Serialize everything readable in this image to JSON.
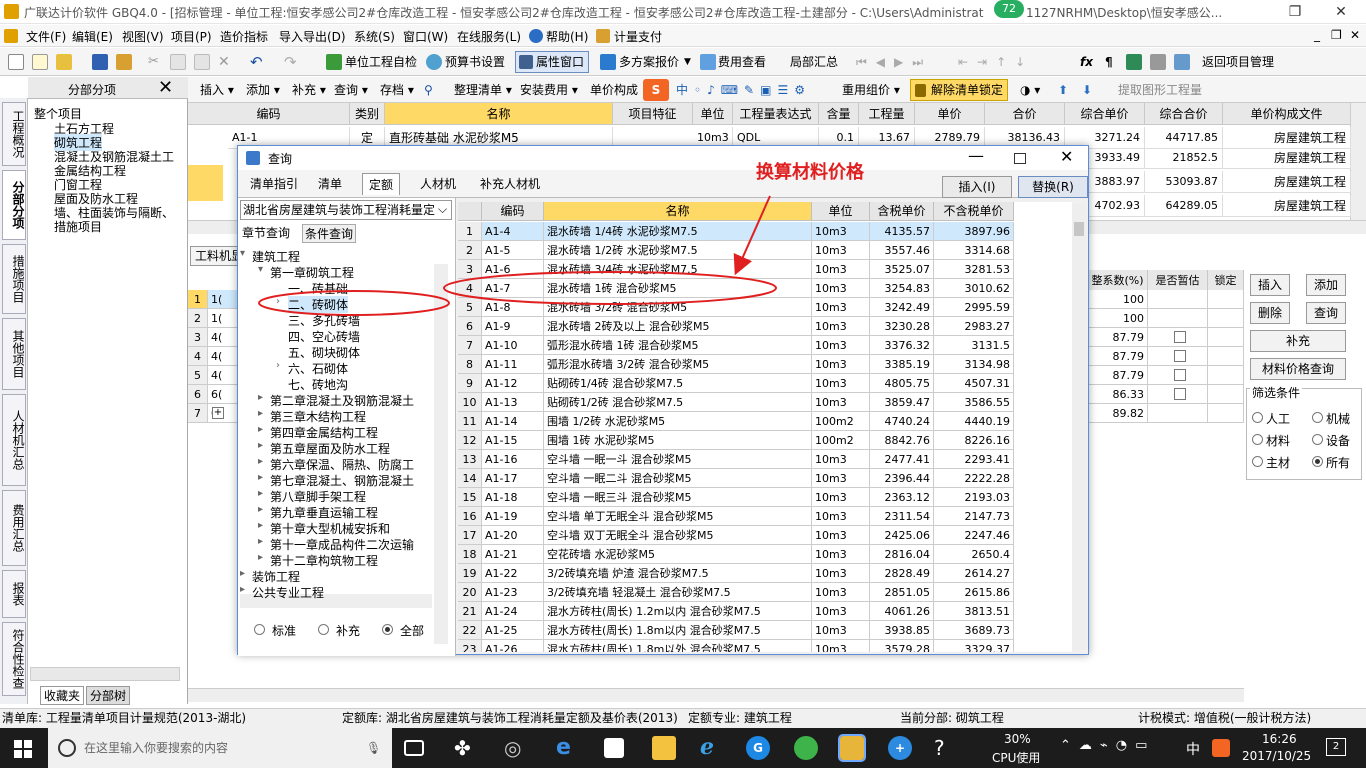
{
  "window": {
    "title": "广联达计价软件 GBQ4.0 - [招标管理 - 单位工程:恒安孝感公司2#仓库改造工程 - 恒安孝感公司2#仓库改造工程 - 恒安孝感公司2#仓库改造工程-土建部分 - C:\\Users\\Administrator.P",
    "title_tail": "1127NRHM\\Desktop\\恒安孝感公...",
    "badge": "72"
  },
  "menu": [
    "文件(F)",
    "编辑(E)",
    "视图(V)",
    "项目(P)",
    "造价指标",
    "导入导出(D)",
    "系统(S)",
    "窗口(W)",
    "在线服务(L)",
    "帮助(H)",
    "计量支付"
  ],
  "toolbar1": {
    "self_check": "单位工程自检",
    "budget_settings": "预算书设置",
    "property_window": "属性窗口",
    "multi_scheme": "多方案报价",
    "fee_view": "费用查看",
    "local_summary": "局部汇总",
    "return_project": "返回项目管理"
  },
  "toolbar2": {
    "insert": "插入",
    "add": "添加",
    "supplement": "补充",
    "query": "查询",
    "save": "存档",
    "organize": "整理清单",
    "install_fee": "安装费用",
    "unit_composition": "单价构成",
    "regroup": "重用组价",
    "unlock": "解除清单锁定",
    "extract": "提取图形工程量"
  },
  "left_panel": {
    "title": "分部分项",
    "items": [
      "整个项目",
      "土石方工程",
      "砌筑工程",
      "混凝土及钢筋混凝土工",
      "金属结构工程",
      "门窗工程",
      "屋面及防水工程",
      "墙、柱面装饰与隔断、",
      "措施项目"
    ],
    "bottom_tabs": [
      "收藏夹",
      "分部树"
    ]
  },
  "vertical_tabs": [
    "工程概况",
    "分部分项",
    "措施项目",
    "其他项目",
    "人材机汇总",
    "费用汇总",
    "报表",
    "符合性检查"
  ],
  "main_grid": {
    "headers": [
      "编码",
      "类别",
      "名称",
      "项目特征",
      "单位",
      "工程量表达式",
      "含量",
      "工程量",
      "单价",
      "合价",
      "综合单价",
      "综合合价",
      "单价构成文件"
    ],
    "row1": {
      "code": "A1-1",
      "type": "定",
      "name": "直形砖基础 水泥砂浆M5",
      "unit": "10m3",
      "expr": "QDL",
      "content": "0.1",
      "qty": "13.67",
      "price": "2789.79",
      "total": "38136.43"
    },
    "right_cols": [
      {
        "unit_price": "3271.24",
        "total": "44717.85",
        "file": "房屋建筑工程"
      },
      {
        "unit_price": "3933.49",
        "total": "21852.5",
        "file": "房屋建筑工程"
      },
      {
        "unit_price": "3883.97",
        "total": "53093.87",
        "file": "房屋建筑工程"
      },
      {
        "unit_price": "4702.93",
        "total": "64289.05",
        "file": "房屋建筑工程"
      }
    ]
  },
  "lower_grid": {
    "tab": "工料机显",
    "headers": [
      "整系数(%)",
      "是否暂估",
      "锁定"
    ],
    "rows": [
      {
        "n": "1",
        "c": "1(",
        "v": "100"
      },
      {
        "n": "2",
        "c": "1(",
        "v": "100"
      },
      {
        "n": "3",
        "c": "4(",
        "v": "87.79"
      },
      {
        "n": "4",
        "c": "4(",
        "v": "87.79"
      },
      {
        "n": "5",
        "c": "4(",
        "v": "87.79"
      },
      {
        "n": "6",
        "c": "6(",
        "v": "86.33"
      },
      {
        "n": "7",
        "c": "0(",
        "v": "89.82"
      }
    ]
  },
  "right_panel": {
    "insert": "插入",
    "add": "添加",
    "delete": "删除",
    "query": "查询",
    "supplement": "补充",
    "material_query": "材料价格查询",
    "filter_title": "筛选条件",
    "filters": [
      "人工",
      "机械",
      "材料",
      "设备",
      "主材",
      "所有"
    ],
    "filter_selected": "所有"
  },
  "dialog": {
    "title": "查询",
    "tabs": [
      "清单指引",
      "清单",
      "定额",
      "人材机",
      "补充人材机"
    ],
    "active_tab": "定额",
    "insert_btn": "插入(I)",
    "replace_btn": "替换(R)",
    "library": "湖北省房屋建筑与装饰工程消耗量定",
    "subtabs": [
      "章节查询",
      "条件查询"
    ],
    "tree": [
      "建筑工程",
      "第一章砌筑工程",
      "一、砖基础",
      "二、砖砌体",
      "三、多孔砖墙",
      "四、空心砖墙",
      "五、砌块砌体",
      "六、石砌体",
      "七、砖地沟",
      "第二章混凝土及钢筋混凝土",
      "第三章木结构工程",
      "第四章金属结构工程",
      "第五章屋面及防水工程",
      "第六章保温、隔热、防腐工",
      "第七章混凝土、钢筋混凝土",
      "第八章脚手架工程",
      "第九章垂直运输工程",
      "第十章大型机械安拆和",
      "第十一章成品构件二次运输",
      "第十二章构筑物工程",
      "装饰工程",
      "公共专业工程"
    ],
    "radios": [
      "标准",
      "补充",
      "全部"
    ],
    "radio_selected": "全部",
    "table_headers": [
      "编码",
      "名称",
      "单位",
      "含税单价",
      "不含税单价"
    ],
    "rows": [
      [
        "1",
        "A1-4",
        "混水砖墙 1/4砖 水泥砂浆M7.5",
        "10m3",
        "4135.57",
        "3897.96"
      ],
      [
        "2",
        "A1-5",
        "混水砖墙 1/2砖 水泥砂浆M7.5",
        "10m3",
        "3557.46",
        "3314.68"
      ],
      [
        "3",
        "A1-6",
        "混水砖墙 3/4砖 水泥砂浆M7.5",
        "10m3",
        "3525.07",
        "3281.53"
      ],
      [
        "4",
        "A1-7",
        "混水砖墙 1砖 混合砂浆M5",
        "10m3",
        "3254.83",
        "3010.62"
      ],
      [
        "5",
        "A1-8",
        "混水砖墙 3/2砖 混合砂浆M5",
        "10m3",
        "3242.49",
        "2995.59"
      ],
      [
        "6",
        "A1-9",
        "混水砖墙 2砖及以上 混合砂浆M5",
        "10m3",
        "3230.28",
        "2983.27"
      ],
      [
        "7",
        "A1-10",
        "弧形混水砖墙 1砖 混合砂浆M5",
        "10m3",
        "3376.32",
        "3131.5"
      ],
      [
        "8",
        "A1-11",
        "弧形混水砖墙 3/2砖 混合砂浆M5",
        "10m3",
        "3385.19",
        "3134.98"
      ],
      [
        "9",
        "A1-12",
        "贴砌砖1/4砖 混合砂浆M7.5",
        "10m3",
        "4805.75",
        "4507.31"
      ],
      [
        "10",
        "A1-13",
        "贴砌砖1/2砖 混合砂浆M7.5",
        "10m3",
        "3859.47",
        "3586.55"
      ],
      [
        "11",
        "A1-14",
        "围墙 1/2砖 水泥砂浆M5",
        "100m2",
        "4740.24",
        "4440.19"
      ],
      [
        "12",
        "A1-15",
        "围墙 1砖 水泥砂浆M5",
        "100m2",
        "8842.76",
        "8226.16"
      ],
      [
        "13",
        "A1-16",
        "空斗墙 一眠一斗 混合砂浆M5",
        "10m3",
        "2477.41",
        "2293.41"
      ],
      [
        "14",
        "A1-17",
        "空斗墙 一眠二斗 混合砂浆M5",
        "10m3",
        "2396.44",
        "2222.28"
      ],
      [
        "15",
        "A1-18",
        "空斗墙 一眠三斗 混合砂浆M5",
        "10m3",
        "2363.12",
        "2193.03"
      ],
      [
        "16",
        "A1-19",
        "空斗墙 单丁无眠全斗 混合砂浆M5",
        "10m3",
        "2311.54",
        "2147.73"
      ],
      [
        "17",
        "A1-20",
        "空斗墙 双丁无眠全斗 混合砂浆M5",
        "10m3",
        "2425.06",
        "2247.46"
      ],
      [
        "18",
        "A1-21",
        "空花砖墙 水泥砂浆M5",
        "10m3",
        "2816.04",
        "2650.4"
      ],
      [
        "19",
        "A1-22",
        "3/2砖填充墙 炉渣 混合砂浆M7.5",
        "10m3",
        "2828.49",
        "2614.27"
      ],
      [
        "20",
        "A1-23",
        "3/2砖填充墙 轻混凝土 混合砂浆M7.5",
        "10m3",
        "2851.05",
        "2615.86"
      ],
      [
        "21",
        "A1-24",
        "混水方砖柱(周长) 1.2m以内 混合砂浆M7.5",
        "10m3",
        "4061.26",
        "3813.51"
      ],
      [
        "22",
        "A1-25",
        "混水方砖柱(周长) 1.8m以内 混合砂浆M7.5",
        "10m3",
        "3938.85",
        "3689.73"
      ],
      [
        "23",
        "A1-26",
        "混水方砖柱(周长) 1.8m以外 混合砂浆M7.5",
        "10m3",
        "3579.28",
        "3329.37"
      ]
    ]
  },
  "annotation": "换算材料价格",
  "statusbar": {
    "list_lib": "清单库: 工程量清单项目计量规范(2013-湖北)",
    "quota_lib": "定额库: 湖北省房屋建筑与装饰工程消耗量定额及基价表(2013)",
    "quota_major": "定额专业: 建筑工程",
    "current": "当前分部: 砌筑工程",
    "tax": "计税模式: 增值税(一般计税方法)"
  },
  "taskbar": {
    "search_placeholder": "在这里输入你要搜索的内容",
    "cpu": "30%",
    "cpu_label": "CPU使用",
    "ime": "中",
    "time": "16:26",
    "date": "2017/10/25",
    "notif": "2"
  },
  "colors": {
    "accent": "#ffd966",
    "annotation": "#e02020",
    "selected_row": "#cfe8fc"
  }
}
